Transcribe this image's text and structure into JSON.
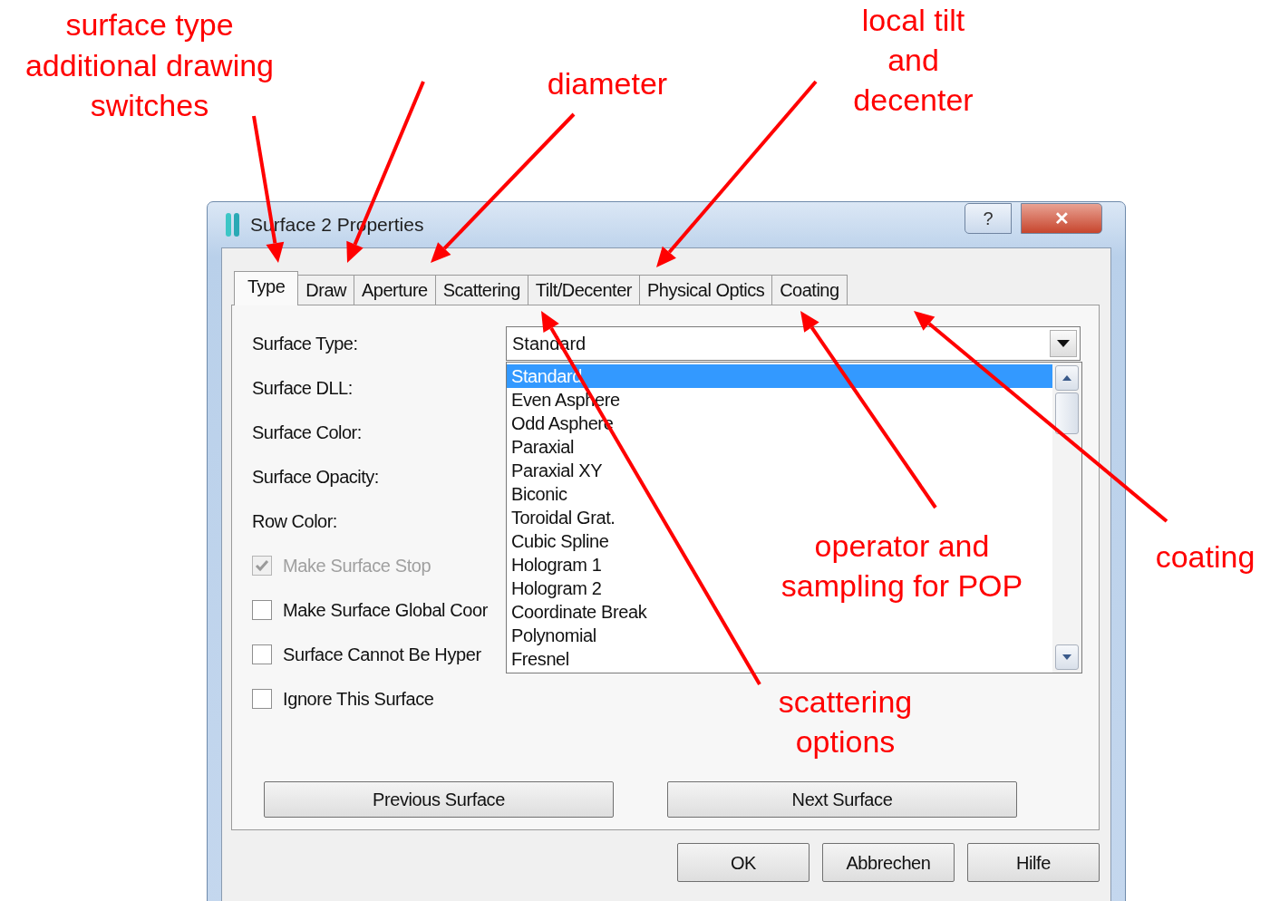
{
  "annotations": [
    {
      "text": "surface type"
    },
    {
      "text": "additional drawing switches"
    },
    {
      "text": "diameter"
    },
    {
      "text": "local tilt and decenter"
    },
    {
      "text": "operator and sampling for POP"
    },
    {
      "text": "coating"
    },
    {
      "text": "scattering options"
    }
  ],
  "window": {
    "title": "Surface 2 Properties",
    "title_buttons": [
      "?",
      "✕"
    ]
  },
  "tabs": [
    {
      "label": "Type",
      "selected": true
    },
    {
      "label": "Draw",
      "selected": false
    },
    {
      "label": "Aperture",
      "selected": false
    },
    {
      "label": "Scattering",
      "selected": false
    },
    {
      "label": "Tilt/Decenter",
      "selected": false
    },
    {
      "label": "Physical Optics",
      "selected": false
    },
    {
      "label": "Coating",
      "selected": false
    }
  ],
  "fields": [
    {
      "label": "Surface Type:"
    },
    {
      "label": "Surface DLL:"
    },
    {
      "label": "Surface Color:"
    },
    {
      "label": "Surface Opacity:"
    },
    {
      "label": "Row Color:"
    }
  ],
  "surface_type": {
    "value": "Standard"
  },
  "dropdown_items": [
    {
      "label": "Standard",
      "selected": true
    },
    {
      "label": "Even Asphere",
      "selected": false
    },
    {
      "label": "Odd Asphere",
      "selected": false
    },
    {
      "label": "Paraxial",
      "selected": false
    },
    {
      "label": "Paraxial XY",
      "selected": false
    },
    {
      "label": "Biconic",
      "selected": false
    },
    {
      "label": "Toroidal Grat.",
      "selected": false
    },
    {
      "label": "Cubic Spline",
      "selected": false
    },
    {
      "label": "Hologram 1",
      "selected": false
    },
    {
      "label": "Hologram 2",
      "selected": false
    },
    {
      "label": "Coordinate Break",
      "selected": false
    },
    {
      "label": "Polynomial",
      "selected": false
    },
    {
      "label": "Fresnel",
      "selected": false
    }
  ],
  "checkboxes": [
    {
      "label": "Make Surface Stop",
      "checked": true,
      "disabled": true
    },
    {
      "label": "Make Surface Global Coor",
      "checked": false,
      "disabled": false
    },
    {
      "label": "Surface Cannot Be Hyper",
      "checked": false,
      "disabled": false
    },
    {
      "label": "Ignore This Surface",
      "checked": false,
      "disabled": false
    }
  ],
  "nav_buttons": [
    "Previous Surface",
    "Next Surface"
  ],
  "buttons": [
    "OK",
    "Abbrechen",
    "Hilfe"
  ]
}
